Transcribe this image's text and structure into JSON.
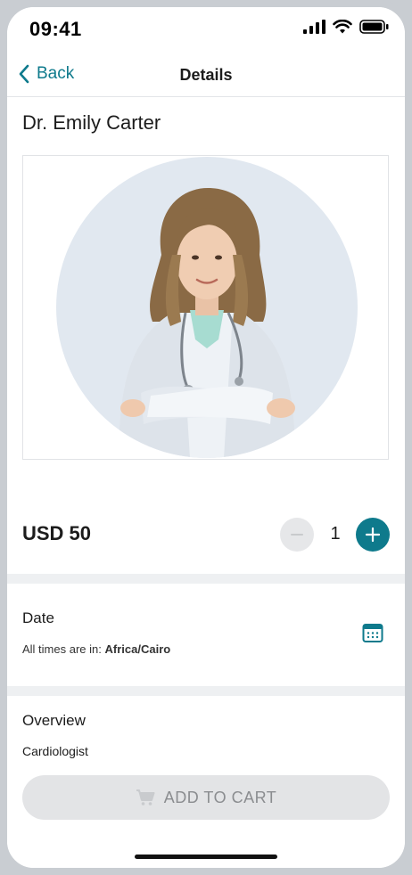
{
  "status_bar": {
    "time": "09:41",
    "icons": [
      "signal-icon",
      "wifi-icon",
      "battery-icon"
    ]
  },
  "nav": {
    "back_label": "Back",
    "title": "Details"
  },
  "doctor": {
    "name": "Dr. Emily Carter",
    "photo": "doctor-portrait"
  },
  "pricing": {
    "price": "USD 50",
    "quantity": "1"
  },
  "date_section": {
    "title": "Date",
    "tz_prefix": "All times are in:",
    "tz_value": "Africa/Cairo"
  },
  "overview": {
    "title": "Overview",
    "text": "Cardiologist"
  },
  "cart": {
    "label": "ADD TO CART",
    "enabled": false
  },
  "colors": {
    "accent": "#0e7a8c",
    "disabled_bg": "#e3e4e6",
    "disabled_text": "#8b8d90",
    "photo_bg": "#e1e8f0"
  }
}
